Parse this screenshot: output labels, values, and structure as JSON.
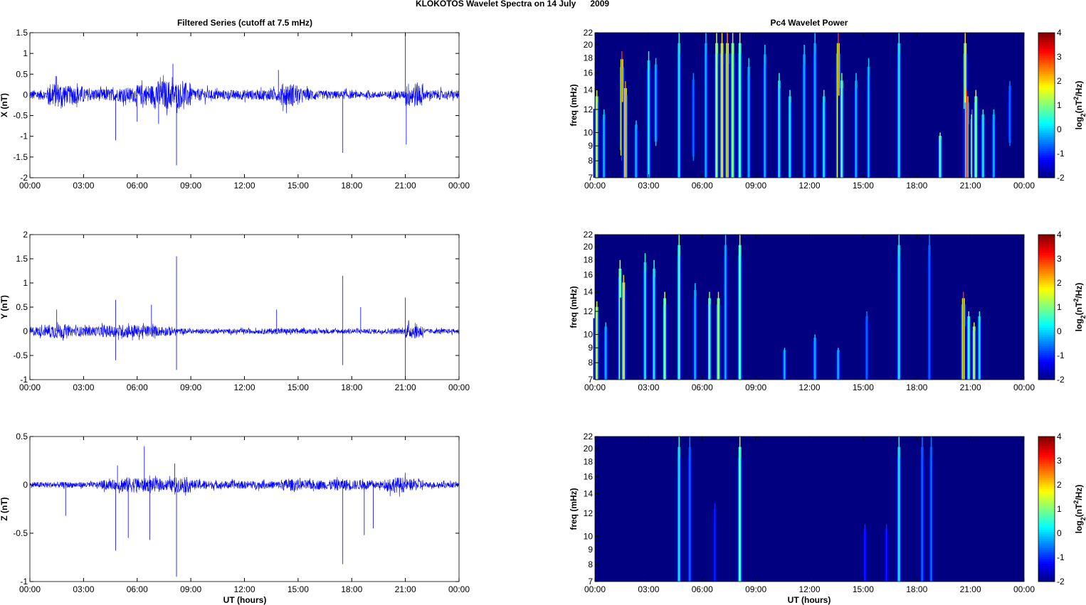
{
  "figure_title": "KLOKOTOS Wavelet Spectra on 14 July      2009",
  "left_title": "Filtered Series (cutoff at 7.5 mHz)",
  "right_title": "Pc4 Wavelet Power",
  "xlabel": "UT (hours)",
  "colors": {
    "trace": "#0000ff"
  },
  "chart_data": [
    {
      "type": "line",
      "component": "X",
      "ylabel": "X (nT)",
      "ylim": [
        -2,
        1.5
      ],
      "yticks": [
        "-2",
        "-1.5",
        "-1",
        "-0.5",
        "0",
        "0.5",
        "1",
        "1.5"
      ],
      "ytick_values": [
        -2,
        -1.5,
        -1,
        -0.5,
        0,
        0.5,
        1,
        1.5
      ],
      "xlim": [
        0,
        24
      ],
      "xticks": [
        "00:00",
        "03:00",
        "06:00",
        "09:00",
        "12:00",
        "15:00",
        "18:00",
        "21:00",
        "00:00"
      ],
      "hourly_amplitude": [
        0.12,
        0.3,
        0.22,
        0.15,
        0.15,
        0.18,
        0.25,
        0.35,
        0.3,
        0.15,
        0.12,
        0.12,
        0.12,
        0.14,
        0.28,
        0.14,
        0.1,
        0.1,
        0.08,
        0.08,
        0.1,
        0.3,
        0.12,
        0.1
      ],
      "spikes": [
        [
          4.8,
          -1.1
        ],
        [
          8.2,
          -1.7
        ],
        [
          8.0,
          0.75
        ],
        [
          7.2,
          -0.7
        ],
        [
          6.0,
          -0.65
        ],
        [
          13.9,
          0.6
        ],
        [
          17.5,
          -1.4
        ],
        [
          21.0,
          1.5
        ],
        [
          21.05,
          -1.2
        ],
        [
          1.5,
          0.45
        ]
      ]
    },
    {
      "type": "line",
      "component": "Y",
      "ylabel": "Y (nT)",
      "ylim": [
        -1,
        2
      ],
      "yticks": [
        "-1",
        "-0.5",
        "0",
        "0.5",
        "1",
        "1.5",
        "2"
      ],
      "ytick_values": [
        -1,
        -0.5,
        0,
        0.5,
        1,
        1.5,
        2
      ],
      "xlim": [
        0,
        24
      ],
      "xticks": [
        "00:00",
        "03:00",
        "06:00",
        "09:00",
        "12:00",
        "15:00",
        "18:00",
        "21:00",
        "00:00"
      ],
      "hourly_amplitude": [
        0.1,
        0.15,
        0.1,
        0.1,
        0.12,
        0.14,
        0.12,
        0.1,
        0.06,
        0.05,
        0.05,
        0.05,
        0.05,
        0.06,
        0.06,
        0.05,
        0.05,
        0.05,
        0.05,
        0.05,
        0.06,
        0.15,
        0.05,
        0.05
      ],
      "spikes": [
        [
          8.2,
          1.55
        ],
        [
          8.2,
          -0.8
        ],
        [
          17.5,
          1.15
        ],
        [
          17.5,
          -0.7
        ],
        [
          4.8,
          0.65
        ],
        [
          4.8,
          -0.6
        ],
        [
          21.0,
          0.7
        ],
        [
          21.0,
          -0.95
        ],
        [
          6.8,
          0.55
        ],
        [
          13.8,
          0.45
        ],
        [
          18.5,
          0.5
        ],
        [
          1.5,
          0.45
        ]
      ]
    },
    {
      "type": "line",
      "component": "Z",
      "ylabel": "Z (nT)",
      "ylim": [
        -1,
        0.5
      ],
      "yticks": [
        "-1",
        "-0.5",
        "0",
        "0.5"
      ],
      "ytick_values": [
        -1,
        -0.5,
        0,
        0.5
      ],
      "xlim": [
        0,
        24
      ],
      "xticks": [
        "00:00",
        "03:00",
        "06:00",
        "09:00",
        "12:00",
        "15:00",
        "18:00",
        "21:00",
        "00:00"
      ],
      "hourly_amplitude": [
        0.03,
        0.03,
        0.03,
        0.03,
        0.05,
        0.08,
        0.07,
        0.06,
        0.08,
        0.05,
        0.04,
        0.04,
        0.04,
        0.04,
        0.06,
        0.05,
        0.05,
        0.06,
        0.05,
        0.04,
        0.08,
        0.06,
        0.03,
        0.03
      ],
      "spikes": [
        [
          8.2,
          -0.95
        ],
        [
          17.5,
          -0.82
        ],
        [
          6.4,
          0.4
        ],
        [
          4.8,
          -0.68
        ],
        [
          5.5,
          -0.55
        ],
        [
          6.7,
          -0.57
        ],
        [
          2.0,
          -0.32
        ],
        [
          18.7,
          -0.52
        ],
        [
          19.2,
          -0.45
        ],
        [
          4.9,
          0.2
        ],
        [
          8.1,
          0.22
        ]
      ]
    },
    {
      "type": "heatmap",
      "component": "X",
      "ylabel": "freq (mHz)",
      "yscale": "log",
      "ylim": [
        7,
        22
      ],
      "yticks": [
        "7",
        "8",
        "9",
        "10",
        "12",
        "14",
        "16",
        "18",
        "20",
        "22"
      ],
      "ytick_values": [
        7,
        8,
        9,
        10,
        12,
        14,
        16,
        18,
        20,
        22
      ],
      "xticks": [
        "00:00",
        "03:00",
        "06:00",
        "09:00",
        "12:00",
        "15:00",
        "18:00",
        "21:00",
        "00:00"
      ],
      "clim": [
        -2,
        4
      ],
      "cticks": [
        "-2",
        "-1",
        "0",
        "1",
        "2",
        "3",
        "4"
      ],
      "clabel": "log2(nT²/Hz)",
      "events_hour_fmin_fmax_power": [
        [
          0.1,
          7,
          14,
          1.5
        ],
        [
          0.5,
          7,
          12,
          0
        ],
        [
          1.5,
          8,
          19,
          3
        ],
        [
          1.7,
          7,
          15,
          2.5
        ],
        [
          2.3,
          7,
          11,
          0
        ],
        [
          3,
          7,
          19,
          0.5
        ],
        [
          3.4,
          9,
          18,
          0
        ],
        [
          4.7,
          7,
          22,
          0.5
        ],
        [
          5.5,
          8,
          16,
          -0.5
        ],
        [
          6.2,
          7,
          22,
          0
        ],
        [
          6.8,
          7,
          22,
          1.5
        ],
        [
          7.1,
          7,
          22,
          2
        ],
        [
          7.4,
          7,
          22,
          2.5
        ],
        [
          7.7,
          7,
          22,
          2
        ],
        [
          8.1,
          7,
          22,
          1.5
        ],
        [
          8.6,
          7,
          18,
          0
        ],
        [
          9.5,
          7,
          20,
          0
        ],
        [
          10.3,
          7,
          16,
          0.5
        ],
        [
          10.9,
          7,
          14,
          0.5
        ],
        [
          11.7,
          7,
          20,
          0
        ],
        [
          12.3,
          7,
          22,
          0
        ],
        [
          12.8,
          7,
          14,
          0.5
        ],
        [
          13.6,
          7,
          22,
          3
        ],
        [
          13.8,
          7,
          16,
          1
        ],
        [
          14.6,
          7,
          16,
          0
        ],
        [
          15.3,
          7,
          18,
          0
        ],
        [
          17.0,
          7,
          22,
          0.5
        ],
        [
          19.3,
          7,
          10,
          1
        ],
        [
          20.7,
          7,
          22,
          2
        ],
        [
          20.8,
          7,
          14,
          3.5
        ],
        [
          21.1,
          7,
          12,
          2
        ],
        [
          21.3,
          7,
          14,
          1.5
        ],
        [
          21.7,
          7,
          12,
          0.5
        ],
        [
          22.3,
          7,
          12,
          0
        ],
        [
          23.2,
          9,
          15,
          -0.5
        ]
      ]
    },
    {
      "type": "heatmap",
      "component": "Y",
      "ylabel": "freq (mHz)",
      "yscale": "log",
      "ylim": [
        7,
        22
      ],
      "yticks": [
        "7",
        "8",
        "9",
        "10",
        "12",
        "14",
        "16",
        "18",
        "20",
        "22"
      ],
      "ytick_values": [
        7,
        8,
        9,
        10,
        12,
        14,
        16,
        18,
        20,
        22
      ],
      "xticks": [
        "00:00",
        "03:00",
        "06:00",
        "09:00",
        "12:00",
        "15:00",
        "18:00",
        "21:00",
        "00:00"
      ],
      "clim": [
        -2,
        4
      ],
      "cticks": [
        "-2",
        "-1",
        "0",
        "1",
        "2",
        "3",
        "4"
      ],
      "clabel": "log2(nT²/Hz)",
      "events_hour_fmin_fmax_power": [
        [
          0.1,
          7,
          13,
          1.5
        ],
        [
          0.6,
          7,
          11,
          0
        ],
        [
          1.4,
          7,
          18,
          1.5
        ],
        [
          1.6,
          7,
          16,
          2
        ],
        [
          2.8,
          7,
          19,
          0.5
        ],
        [
          3.3,
          7,
          18,
          0.5
        ],
        [
          3.9,
          7,
          14,
          1.5
        ],
        [
          4.7,
          7,
          22,
          1
        ],
        [
          5.6,
          7,
          15,
          0
        ],
        [
          6.4,
          7,
          14,
          1
        ],
        [
          6.9,
          7,
          14,
          2
        ],
        [
          7.3,
          7,
          22,
          0
        ],
        [
          8.1,
          7,
          22,
          1.5
        ],
        [
          10.6,
          7,
          9,
          0
        ],
        [
          12.3,
          7,
          10,
          0
        ],
        [
          13.6,
          7,
          9,
          0
        ],
        [
          15.2,
          7,
          12,
          -0.5
        ],
        [
          17.0,
          7,
          22,
          0.5
        ],
        [
          18.7,
          7,
          22,
          -0.5
        ],
        [
          20.6,
          7,
          14,
          3
        ],
        [
          20.9,
          7,
          12,
          1
        ],
        [
          21.2,
          7,
          11,
          1.5
        ],
        [
          21.5,
          7,
          12,
          0.5
        ]
      ]
    },
    {
      "type": "heatmap",
      "component": "Z",
      "ylabel": "freq (mHz)",
      "yscale": "log",
      "ylim": [
        7,
        22
      ],
      "yticks": [
        "7",
        "8",
        "9",
        "10",
        "12",
        "14",
        "16",
        "18",
        "20",
        "22"
      ],
      "ytick_values": [
        7,
        8,
        9,
        10,
        12,
        14,
        16,
        18,
        20,
        22
      ],
      "xticks": [
        "00:00",
        "03:00",
        "06:00",
        "09:00",
        "12:00",
        "15:00",
        "18:00",
        "21:00",
        "00:00"
      ],
      "clim": [
        -2,
        4
      ],
      "cticks": [
        "-2",
        "-1",
        "0",
        "1",
        "2",
        "3",
        "4"
      ],
      "clabel": "log2(nT²/Hz)",
      "events_hour_fmin_fmax_power": [
        [
          4.7,
          7,
          22,
          0.5
        ],
        [
          5.3,
          7,
          22,
          -0.5
        ],
        [
          6.7,
          7,
          13,
          -1
        ],
        [
          8.1,
          7,
          22,
          1.5
        ],
        [
          15.1,
          7,
          11,
          -1
        ],
        [
          16.3,
          7,
          11,
          -1
        ],
        [
          17.0,
          7,
          22,
          0.5
        ],
        [
          18.3,
          7,
          22,
          -0.5
        ],
        [
          18.8,
          7,
          22,
          -0.5
        ]
      ]
    }
  ]
}
